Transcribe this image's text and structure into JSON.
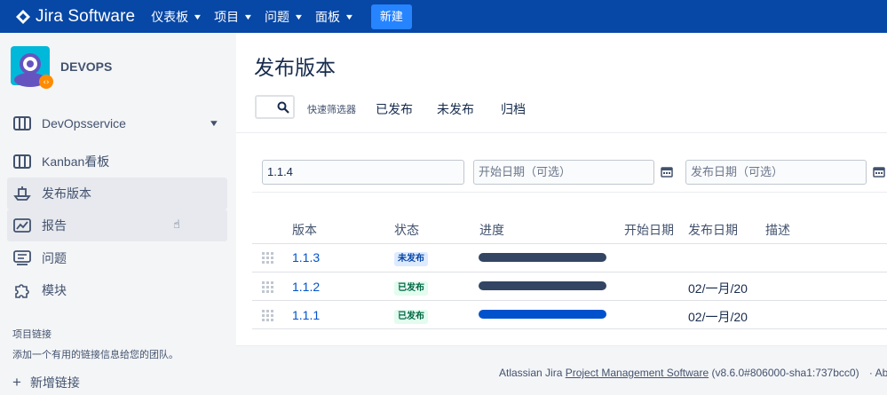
{
  "topbar": {
    "logo_text": "Jira Software",
    "nav": [
      {
        "label": "仪表板"
      },
      {
        "label": "项目"
      },
      {
        "label": "问题"
      },
      {
        "label": "面板"
      }
    ],
    "create_label": "新建",
    "bg_color": "#0747a6",
    "create_color": "#2684ff"
  },
  "sidebar": {
    "project_name": "DEVOPS",
    "items": [
      {
        "label": "DevOpsservice",
        "icon": "board-icon"
      },
      {
        "label": "Kanban看板",
        "icon": "board-icon"
      },
      {
        "label": "发布版本",
        "icon": "ship-icon"
      },
      {
        "label": "报告",
        "icon": "chart-icon"
      },
      {
        "label": "问题",
        "icon": "issues-icon"
      },
      {
        "label": "模块",
        "icon": "puzzle-icon"
      }
    ],
    "section_title": "项目链接",
    "section_text": "添加一个有用的链接信息给您的团队。",
    "add_link": "新增链接"
  },
  "main": {
    "title": "发布版本",
    "quick_filter_label": "快速筛选器",
    "filters": [
      "已发布",
      "未发布",
      "归档"
    ],
    "form": {
      "version_value": "1.1.4",
      "start_date_placeholder": "开始日期（可选）",
      "release_date_placeholder": "发布日期（可选）"
    },
    "table": {
      "headers": {
        "version": "版本",
        "status": "状态",
        "progress": "进度",
        "start_date": "开始日期",
        "release_date": "发布日期",
        "description": "描述"
      },
      "rows": [
        {
          "version": "1.1.3",
          "status": "未发布",
          "status_kind": "unreleased",
          "progress_color": "#344563",
          "release_date": ""
        },
        {
          "version": "1.1.2",
          "status": "已发布",
          "status_kind": "released",
          "progress_color": "#344563",
          "release_date": "02/一月/20"
        },
        {
          "version": "1.1.1",
          "status": "已发布",
          "status_kind": "released",
          "progress_color": "#0052cc",
          "release_date": "02/一月/20"
        }
      ]
    },
    "footer": {
      "prefix": "Atlassian Jira ",
      "link": "Project Management Software",
      "suffix": " (v8.6.0#806000-sha1:737bcc0)",
      "trailing": "· Ab"
    }
  }
}
